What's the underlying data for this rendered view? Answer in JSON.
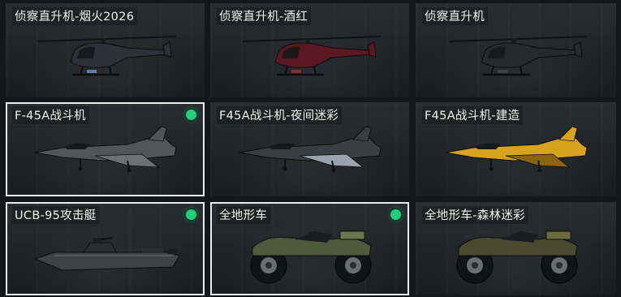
{
  "cards": [
    {
      "label": "侦察直升机-烟火2026",
      "kind": "helicopter",
      "color": "#2c3038",
      "accent": "#6a7a9a",
      "equipped": false,
      "selected": false
    },
    {
      "label": "侦察直升机-酒红",
      "kind": "helicopter",
      "color": "#5a1820",
      "accent": "#8a2a34",
      "equipped": false,
      "selected": false
    },
    {
      "label": "侦察直升机",
      "kind": "helicopter",
      "color": "#262a2c",
      "accent": "#3c4246",
      "equipped": false,
      "selected": false
    },
    {
      "label": "F-45A战斗机",
      "kind": "jet",
      "color": "#50555a",
      "accent": "#6b7074",
      "equipped": true,
      "selected": true
    },
    {
      "label": "F45A战斗机-夜间迷彩",
      "kind": "jet",
      "color": "#3a3e44",
      "accent": "#9aa2ac",
      "equipped": false,
      "selected": false
    },
    {
      "label": "F45A战斗机-建造",
      "kind": "jet",
      "color": "#d7a21c",
      "accent": "#8a6410",
      "equipped": false,
      "selected": false
    },
    {
      "label": "UCB-95攻击艇",
      "kind": "boat",
      "color": "#3e4246",
      "accent": "#5a5f64",
      "equipped": true,
      "selected": true
    },
    {
      "label": "全地形车",
      "kind": "atv",
      "color": "#4e5a3c",
      "accent": "#6a7650",
      "equipped": true,
      "selected": true
    },
    {
      "label": "全地形车-森林迷彩",
      "kind": "atv",
      "color": "#4a4a30",
      "accent": "#6c6a40",
      "equipped": false,
      "selected": false
    }
  ]
}
